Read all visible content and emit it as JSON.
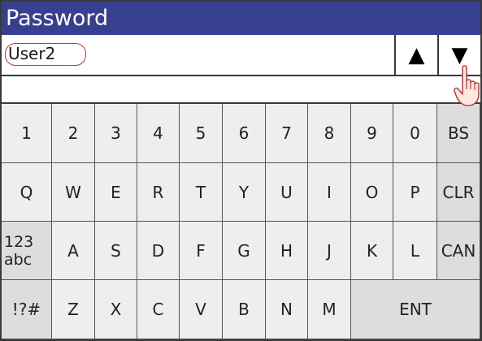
{
  "title": "Password",
  "user": {
    "value": "User2",
    "up_arrow": "▲",
    "down_arrow": "▼"
  },
  "password": {
    "value": ""
  },
  "keyboard": {
    "row1": [
      "1",
      "2",
      "3",
      "4",
      "5",
      "6",
      "7",
      "8",
      "9",
      "0",
      "BS"
    ],
    "row2": [
      "Q",
      "W",
      "E",
      "R",
      "T",
      "Y",
      "U",
      "I",
      "O",
      "P",
      "CLR"
    ],
    "row3": [
      "123\nabc",
      "A",
      "S",
      "D",
      "F",
      "G",
      "H",
      "J",
      "K",
      "L",
      "CAN"
    ],
    "row4": [
      "!?#",
      "Z",
      "X",
      "C",
      "V",
      "B",
      "N",
      "M",
      "ENT"
    ]
  },
  "colors": {
    "title_bar": "#373f8f",
    "key": "#eeeeee",
    "function_key": "#dddddd",
    "highlight": "#b73b46"
  },
  "icons": {
    "pointer": "hand-pointer-icon"
  }
}
